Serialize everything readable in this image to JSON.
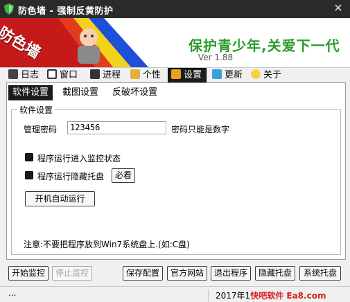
{
  "window": {
    "title": "防色墙 - 强制反黄防护",
    "close_glyph": "✕"
  },
  "banner": {
    "logo": "防色墙",
    "slogan": "保护青少年,关爱下一代",
    "version": "Ver 1.88"
  },
  "main_tabs": [
    {
      "label": "日志",
      "icon": "log-icon"
    },
    {
      "label": "窗口",
      "icon": "window-icon"
    },
    {
      "label": "进程",
      "icon": "process-icon"
    },
    {
      "label": "个性",
      "icon": "personalize-icon"
    },
    {
      "label": "设置",
      "icon": "settings-icon"
    },
    {
      "label": "更新",
      "icon": "update-icon"
    },
    {
      "label": "关于",
      "icon": "about-icon"
    }
  ],
  "active_main_tab": "设置",
  "sub_tabs": [
    "软件设置",
    "截图设置",
    "反破坏设置"
  ],
  "active_sub_tab": "软件设置",
  "settings": {
    "group_title": "软件设置",
    "password_label": "管理密码",
    "password_value": "123456",
    "password_hint": "密码只能是数字",
    "monitor_checkbox": "程序运行进入监控状态",
    "hide_tray_checkbox": "程序运行隐藏托盘",
    "must_see_button": "必看",
    "autostart_button": "开机自动运行",
    "note": "注意:不要把程序放到Win7系统盘上.(如:C盘)"
  },
  "bottom_buttons": {
    "start": "开始监控",
    "stop": "停止监控",
    "save": "保存配置",
    "website": "官方网站",
    "exit": "退出程序",
    "hide_tray": "隐藏托盘",
    "system_tray": "系统托盘"
  },
  "status": {
    "left": "...",
    "date": "2017年1",
    "watermark": "快吧软件 Ea",
    "tail": "8.com"
  },
  "colors": {
    "slogan": "#2a9d2a",
    "titlebar": "#2b2b2b",
    "watermark": "#d92020"
  }
}
